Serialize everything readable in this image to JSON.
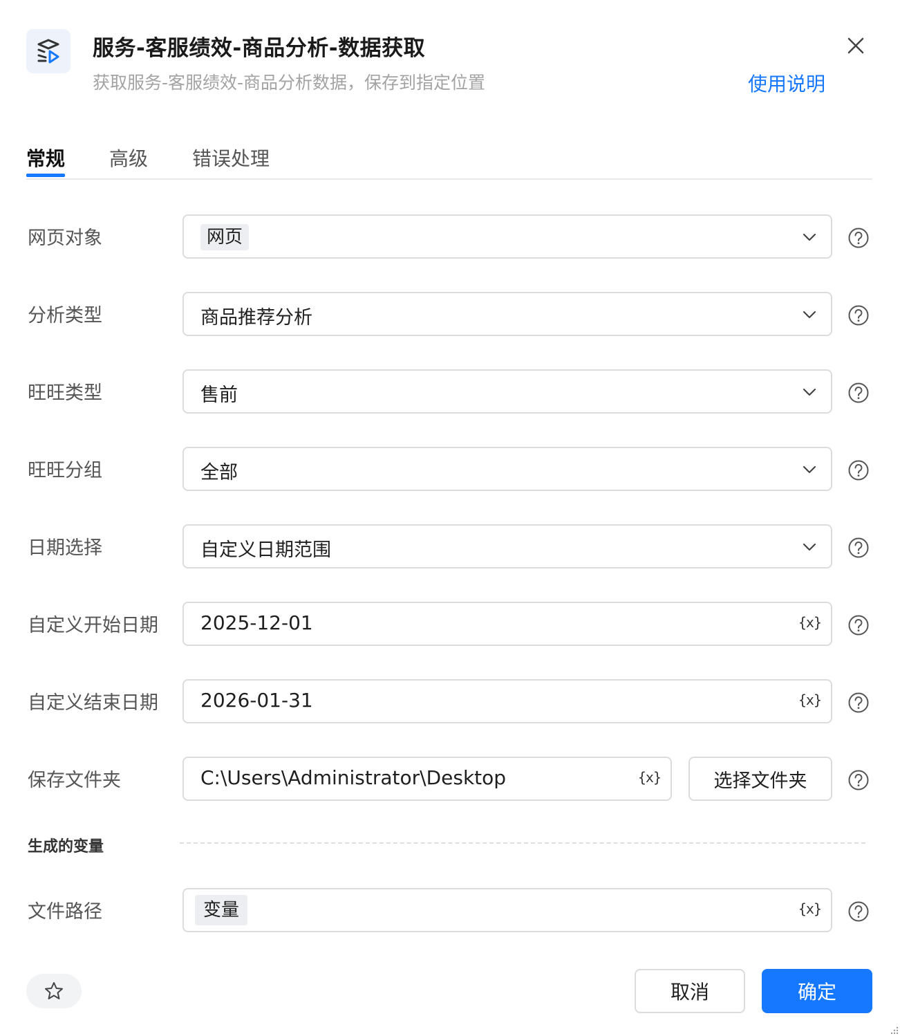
{
  "header": {
    "title": "服务-客服绩效-商品分析-数据获取",
    "subtitle": "获取服务-客服绩效-商品分析数据，保存到指定位置",
    "help_link": "使用说明",
    "app_icon": "list-play-icon",
    "close_icon": "close-icon"
  },
  "tabs": [
    {
      "label": "常规",
      "active": true
    },
    {
      "label": "高级",
      "active": false
    },
    {
      "label": "错误处理",
      "active": false
    }
  ],
  "form": {
    "web_object": {
      "label": "网页对象",
      "value": "网页"
    },
    "analysis_type": {
      "label": "分析类型",
      "value": "商品推荐分析"
    },
    "wangwang_type": {
      "label": "旺旺类型",
      "value": "售前"
    },
    "wangwang_group": {
      "label": "旺旺分组",
      "value": "全部"
    },
    "date_select": {
      "label": "日期选择",
      "value": "自定义日期范围"
    },
    "start_date": {
      "label": "自定义开始日期",
      "value": "2025-12-01"
    },
    "end_date": {
      "label": "自定义结束日期",
      "value": "2026-01-31"
    },
    "save_folder": {
      "label": "保存文件夹",
      "value": "C:\\Users\\Administrator\\Desktop",
      "button": "选择文件夹"
    },
    "variable_marker": "{x}"
  },
  "generated": {
    "section_title": "生成的变量",
    "file_path": {
      "label": "文件路径",
      "value": "变量"
    }
  },
  "footer": {
    "cancel": "取消",
    "ok": "确定",
    "star_icon": "star-icon"
  },
  "colors": {
    "accent": "#1677ff",
    "border": "#dcdcdc",
    "chip_bg": "#eceef1",
    "muted_text": "#a3a3a3"
  }
}
